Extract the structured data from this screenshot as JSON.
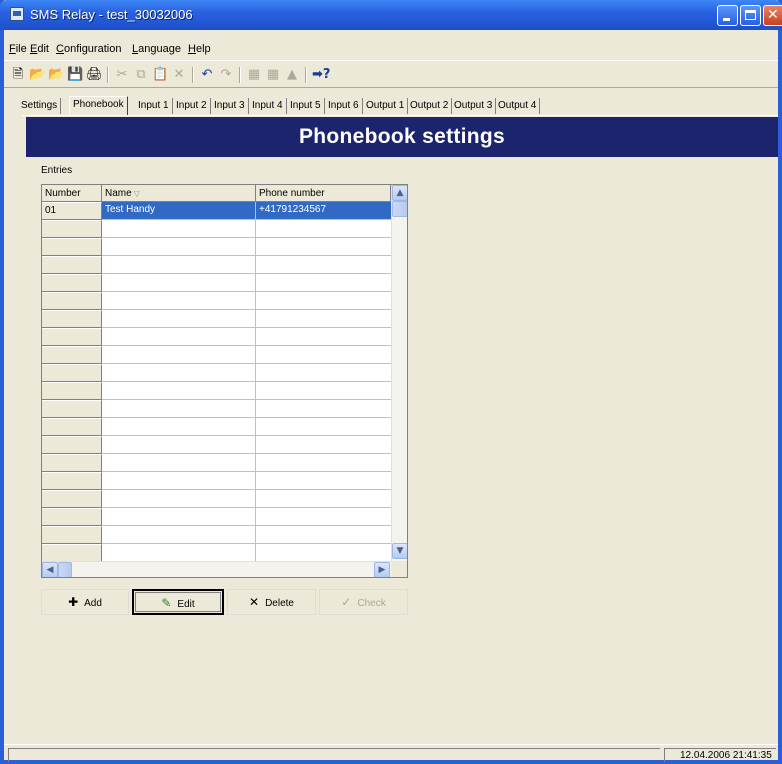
{
  "window": {
    "title": "SMS Relay - test_30032006"
  },
  "menu": [
    {
      "label": "File",
      "accel": "F",
      "rest": "ile"
    },
    {
      "label": "Edit",
      "accel": "E",
      "rest": "dit"
    },
    {
      "label": "Configuration",
      "accel": "C",
      "rest": "onfiguration"
    },
    {
      "label": "Language",
      "accel": "L",
      "rest": "anguage"
    },
    {
      "label": "Help",
      "accel": "H",
      "rest": "elp"
    }
  ],
  "toolbar": {
    "icons": [
      "new-file-icon",
      "open-icon",
      "import-icon",
      "save-icon",
      "print-icon",
      "cut-icon",
      "copy-icon",
      "paste-icon",
      "delete-icon",
      "undo-icon",
      "redo-icon",
      "read-device-icon",
      "write-device-icon",
      "upload-icon",
      "whats-this-help-icon"
    ]
  },
  "tabs": [
    "Settings",
    "Phonebook",
    "Input 1",
    "Input 2",
    "Input 3",
    "Input 4",
    "Input 5",
    "Input 6",
    "Output 1",
    "Output 2",
    "Output 3",
    "Output 4"
  ],
  "active_tab": "Phonebook",
  "header": {
    "title": "Phonebook settings",
    "bg_color": "#1c246e"
  },
  "entries": {
    "label": "Entries",
    "columns": [
      "Number",
      "Name",
      "Phone number"
    ],
    "rows": [
      {
        "number": "01",
        "name": "Test Handy",
        "phone": "+41791234567",
        "selected": true
      }
    ],
    "selection_color": "#316ac5"
  },
  "buttons": {
    "add": "Add",
    "edit": "Edit",
    "delete": "Delete",
    "check": "Check"
  },
  "status": {
    "datetime": "12.04.2006 21:41:35"
  }
}
